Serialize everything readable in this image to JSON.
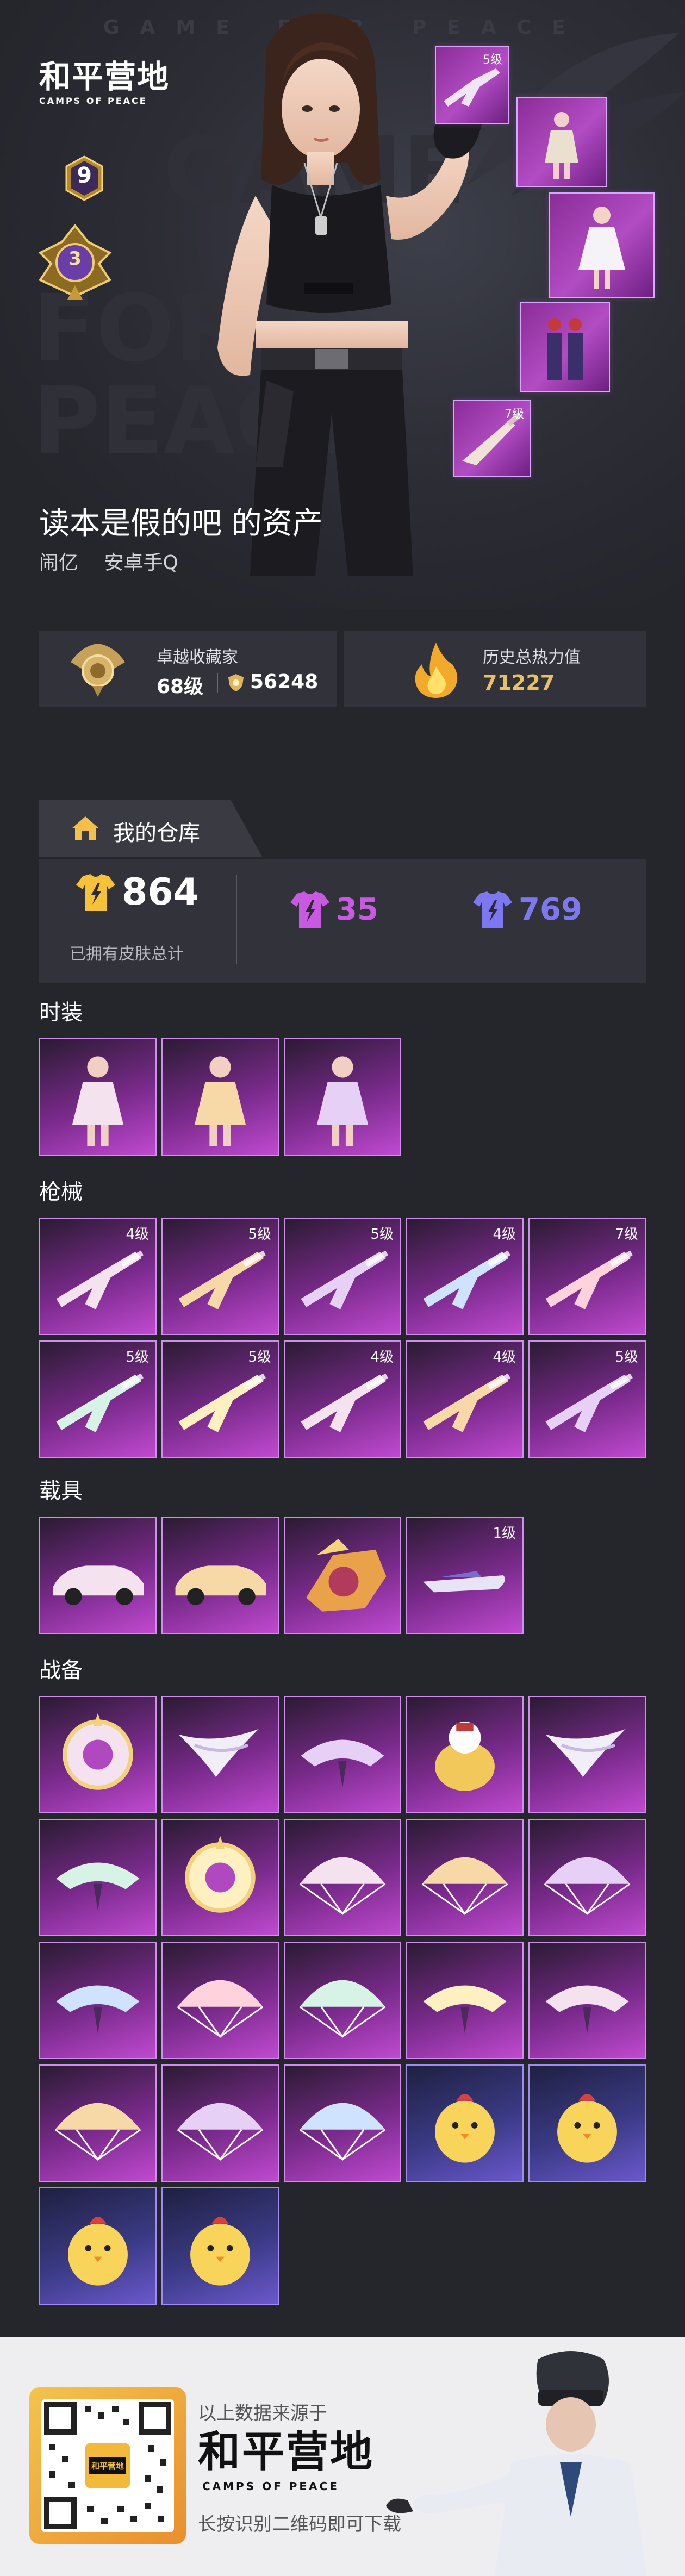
{
  "header": {
    "watermark_top": "GAME FOR PEACE",
    "watermark_big": [
      "GAME",
      "FOR",
      "PEACE"
    ],
    "logo_cn": "和平营地",
    "logo_en": "CAMPS OF PEACE",
    "level": "9",
    "rank": "3",
    "owner_title": "读本是假的吧 的资产",
    "owner_region": "闹亿",
    "owner_platform": "安卓手Q"
  },
  "hero_items": [
    {
      "kind": "gun",
      "level": "5级"
    },
    {
      "kind": "outfit"
    },
    {
      "kind": "outfit"
    },
    {
      "kind": "outfit"
    },
    {
      "kind": "gun",
      "level": "7级"
    }
  ],
  "stats": {
    "collector_label": "卓越收藏家",
    "collector_level": "68级",
    "collector_score": "56248",
    "heat_label": "历史总热力值",
    "heat_value": "71227"
  },
  "warehouse": {
    "tab_title": "我的仓库",
    "total_skins": "864",
    "total_label": "已拥有皮肤总计",
    "purple_count": "35",
    "blue_count": "769",
    "colors": {
      "gold": "#f5c23a",
      "purple": "#c75ae0",
      "blue": "#7d78f0"
    }
  },
  "sections": {
    "fashion": {
      "title": "时装",
      "items": [
        {
          "kind": "outfit"
        },
        {
          "kind": "outfit"
        },
        {
          "kind": "outfit"
        }
      ]
    },
    "guns": {
      "title": "枪械",
      "items": [
        {
          "kind": "gun",
          "level": "4级"
        },
        {
          "kind": "gun",
          "level": "5级"
        },
        {
          "kind": "gun",
          "level": "5级"
        },
        {
          "kind": "gun",
          "level": "4级"
        },
        {
          "kind": "gun",
          "level": "7级"
        },
        {
          "kind": "gun",
          "level": "5级"
        },
        {
          "kind": "gun",
          "level": "5级"
        },
        {
          "kind": "gun",
          "level": "4级"
        },
        {
          "kind": "gun",
          "level": "4级"
        },
        {
          "kind": "gun",
          "level": "5级"
        }
      ]
    },
    "vehicles": {
      "title": "载具",
      "items": [
        {
          "kind": "car"
        },
        {
          "kind": "car"
        },
        {
          "kind": "vehicle"
        },
        {
          "kind": "boat",
          "level": "1级"
        }
      ]
    },
    "gear": {
      "title": "战备",
      "items": [
        {
          "kind": "emblem"
        },
        {
          "kind": "wings"
        },
        {
          "kind": "glider"
        },
        {
          "kind": "mascot"
        },
        {
          "kind": "wings"
        },
        {
          "kind": "glider"
        },
        {
          "kind": "emblem"
        },
        {
          "kind": "parachute"
        },
        {
          "kind": "parachute"
        },
        {
          "kind": "parachute"
        },
        {
          "kind": "glider"
        },
        {
          "kind": "parachute"
        },
        {
          "kind": "parachute"
        },
        {
          "kind": "glider"
        },
        {
          "kind": "glider"
        },
        {
          "kind": "parachute"
        },
        {
          "kind": "parachute"
        },
        {
          "kind": "parachute"
        },
        {
          "kind": "chick",
          "variant": "blue"
        },
        {
          "kind": "chick",
          "variant": "blue"
        },
        {
          "kind": "chick",
          "variant": "blue"
        },
        {
          "kind": "chick",
          "variant": "blue"
        }
      ]
    }
  },
  "footer": {
    "source_text": "以上数据来源于",
    "logo_cn": "和平营地",
    "logo_en": "CAMPS OF PEACE",
    "hint": "长按识别二维码即可下载",
    "qr_label": "和平营地"
  }
}
